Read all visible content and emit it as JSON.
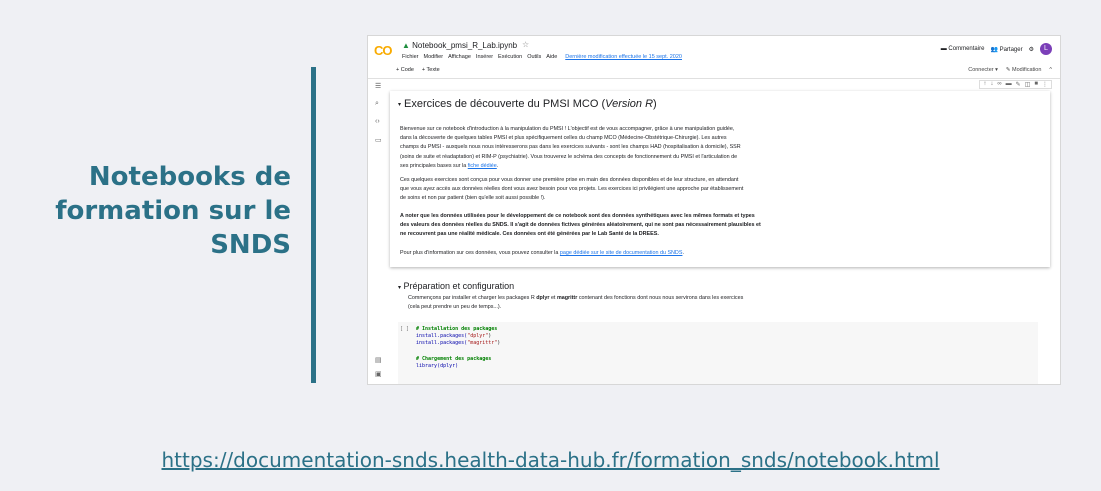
{
  "slide": {
    "title": "Notebooks de formation sur le SNDS",
    "link": "https://documentation-snds.health-data-hub.fr/formation_snds/notebook.html"
  },
  "colab": {
    "logo": "CO",
    "notebook_title": "Notebook_pmsi_R_Lab.ipynb",
    "menu": [
      "Fichier",
      "Modifier",
      "Affichage",
      "Insérer",
      "Exécution",
      "Outils",
      "Aide"
    ],
    "last_modified": "Dernière modification effectuée le 15 sept. 2020",
    "comment_label": "Commentaire",
    "share_label": "Partager",
    "avatar_letter": "L",
    "add_code": "+ Code",
    "add_text": "+ Texte",
    "connect": "Connecter",
    "edit_mode": "Modification",
    "section1": {
      "title_prefix": "Exercices de découverte du PMSI MCO (",
      "title_em": "Version R",
      "title_suffix": ")",
      "p1a": "Bienvenue sur ce notebook d'introduction à la manipulation du PMSI ! L'objectif est de vous accompagner, grâce à une manipulation guidée,",
      "p1b": "dans la découverte de quelques tables PMSI et plus spécifiquement celles du champ MCO (Médecine-Obstétrique-Chirurgie). Les autres",
      "p1c": "champs du PMSI - auxquels nous nous intéresserons pas dans les exercices suivants - sont les champs HAD (hospitalisation à domicile), SSR",
      "p1d": "(soins de suite et réadaptation) et RIM-P (psychiatrie). Vous trouverez le schéma des concepts de fonctionnement du PMSI et l'articulation de",
      "p1e": "ses principales bases sur la",
      "p1_link": "fiche dédiée",
      "p2a": "Ces quelques exercices sont conçus pour vous donner une première prise en main des données disponibles et de leur structure, en attendant",
      "p2b": "que vous ayez accès aux données réelles dont vous avez besoin pour vos projets. Les exercices ici privilégient une approche par établissement",
      "p2c": "de soins et non par patient (bien qu'elle soit aussi possible !).",
      "p3a": "A noter que les données utilisées pour le développement de ce notebook sont des données synthétiques avec les mêmes formats et types",
      "p3b": "des valeurs des données réelles du SNDS. Il s'agit de données fictives générées aléatoirement, qui ne sont pas nécessairement plausibles et",
      "p3c": "ne recouvrent pas une réalité médicale. Ces données ont été générées par le Lab Santé de la DREES.",
      "p4": "Pour plus d'information sur ces données, vous pouvez consulter la",
      "p4_link": "page dédiée sur le site de documentation du SNDS"
    },
    "section2": {
      "title": "Préparation et configuration",
      "p1a_pre": "Commençons par installer et charger les packages R",
      "pkg1": "dplyr",
      "and": "et",
      "pkg2": "magrittr",
      "p1a_post": "contenant des fonctions dont nous nous servirons dans les exercices",
      "p1b": "(cela peut prendre un peu de temps...)."
    },
    "code": {
      "gutter": "[ ]",
      "l1": "# Installation des packages",
      "l2a": "install.packages(",
      "l2b": "\"dplyr\"",
      "l3b": "\"magrittr\"",
      "close": ")",
      "l4": "# Chargement des packages",
      "l5": "library(dplyr)"
    }
  }
}
